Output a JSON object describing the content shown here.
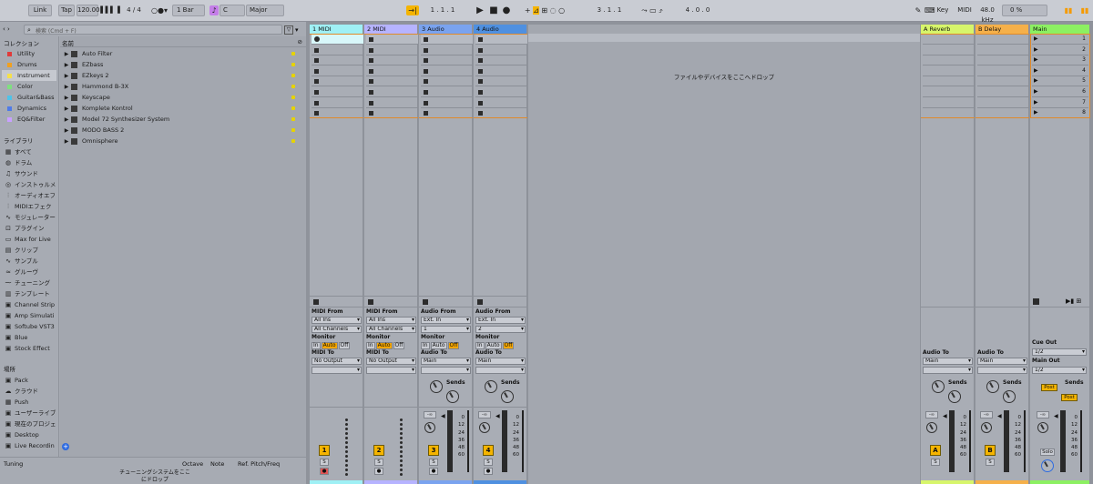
{
  "transport": {
    "link": "Link",
    "tap": "Tap",
    "tempo": "120.00",
    "time_sig": "4 / 4",
    "quantize": "1 Bar",
    "key": "C",
    "scale": "Major",
    "position": "1 .   1 .   1",
    "loop_start": "3 .   1 .   1",
    "loop_length": "4 .   0 .   0",
    "key_label": "Key",
    "midi_label": "MIDI",
    "sample_rate": "48.0 kHz",
    "cpu": "0 %"
  },
  "browser": {
    "search_placeholder": "検索 (Cmd + F)",
    "collections_header": "コレクション",
    "name_header": "名前",
    "collections": [
      {
        "label": "Utility",
        "color": "#e03b3b"
      },
      {
        "label": "Drums",
        "color": "#f0a020"
      },
      {
        "label": "Instrument",
        "color": "#f5e04a"
      },
      {
        "label": "Color",
        "color": "#7fe07f"
      },
      {
        "label": "Guitar&Bass",
        "color": "#4fc3e8"
      },
      {
        "label": "Dynamics",
        "color": "#4f7be8"
      },
      {
        "label": "EQ&Filter",
        "color": "#c9a0ff"
      }
    ],
    "library_header": "ライブラリ",
    "library": [
      {
        "label": "すべて",
        "icon": "grid-icon"
      },
      {
        "label": "ドラム",
        "icon": "drum-icon"
      },
      {
        "label": "サウンド",
        "icon": "sound-icon"
      },
      {
        "label": "インストゥルメ",
        "icon": "instrument-icon"
      },
      {
        "label": "オーディオエフ",
        "icon": "audio-fx-icon"
      },
      {
        "label": "MIDIエフェク",
        "icon": "midi-fx-icon"
      },
      {
        "label": "モジュレーター",
        "icon": "modulator-icon"
      },
      {
        "label": "プラグイン",
        "icon": "plugin-icon"
      },
      {
        "label": "Max for Live",
        "icon": "max-icon"
      },
      {
        "label": "クリップ",
        "icon": "clip-icon"
      },
      {
        "label": "サンプル",
        "icon": "sample-icon"
      },
      {
        "label": "グルーヴ",
        "icon": "groove-icon"
      },
      {
        "label": "チューニング",
        "icon": "tuning-icon"
      },
      {
        "label": "テンプレート",
        "icon": "template-icon"
      },
      {
        "label": "Channel Strip",
        "icon": "pack-icon"
      },
      {
        "label": "Amp Simulati",
        "icon": "pack-icon"
      },
      {
        "label": "Softube VST3",
        "icon": "pack-icon"
      },
      {
        "label": "Blue",
        "icon": "pack-icon"
      },
      {
        "label": "Stock Effect",
        "icon": "pack-icon"
      }
    ],
    "places_header": "場所",
    "places": [
      {
        "label": "Pack",
        "icon": "pack-icon"
      },
      {
        "label": "クラウド",
        "icon": "cloud-icon"
      },
      {
        "label": "Push",
        "icon": "push-icon"
      },
      {
        "label": "ユーザーライブ",
        "icon": "user-library-icon"
      },
      {
        "label": "現在のプロジェ",
        "icon": "project-icon"
      },
      {
        "label": "Desktop",
        "icon": "folder-icon"
      },
      {
        "label": "Live Recordin",
        "icon": "folder-icon"
      }
    ],
    "items": [
      {
        "label": "Auto Filter"
      },
      {
        "label": "EZbass"
      },
      {
        "label": "EZkeys 2"
      },
      {
        "label": "Hammond B-3X"
      },
      {
        "label": "Keyscape"
      },
      {
        "label": "Komplete Kontrol"
      },
      {
        "label": "Model 72 Synthesizer System"
      },
      {
        "label": "MODO BASS 2"
      },
      {
        "label": "Omnisphere"
      }
    ],
    "tuning": {
      "title": "Tuning",
      "col_octave": "Octave",
      "col_note": "Note",
      "col_ref": "Ref. Pitch/Freq",
      "drop_hint": "チューニングシステムをここにドロップ"
    }
  },
  "session": {
    "drop_hint": "ファイルやデバイスをここへドロップ",
    "tracks": [
      {
        "name": "1 MIDI",
        "color": "#9ff0f5",
        "type": "midi",
        "number": "1",
        "io_label": "MIDI From",
        "in": "All Ins",
        "ch": "All Channels",
        "out_label": "MIDI To",
        "out": "No Output"
      },
      {
        "name": "2 MIDI",
        "color": "#b6b3ff",
        "type": "midi",
        "number": "2",
        "io_label": "MIDI From",
        "in": "All Ins",
        "ch": "All Channels",
        "out_label": "MIDI To",
        "out": "No Output"
      },
      {
        "name": "3 Audio",
        "color": "#7aa3ef",
        "type": "audio",
        "number": "3",
        "io_label": "Audio From",
        "in": "Ext. In",
        "ch": "1",
        "out_label": "Audio To",
        "out": "Main"
      },
      {
        "name": "4 Audio",
        "color": "#4f90e0",
        "type": "audio",
        "number": "4",
        "io_label": "Audio From",
        "in": "Ext. In",
        "ch": "2",
        "out_label": "Audio To",
        "out": "Main"
      }
    ],
    "returns": [
      {
        "name": "A Reverb",
        "color": "#d7f56b",
        "letter": "A"
      },
      {
        "name": "B Delay",
        "color": "#f5b04a",
        "letter": "B"
      }
    ],
    "main": {
      "name": "Main",
      "color": "#8cf062",
      "scenes": [
        "1",
        "2",
        "3",
        "4",
        "5",
        "6",
        "7",
        "8"
      ],
      "cue_out_label": "Cue Out",
      "cue_out": "1/2",
      "main_out_label": "Main Out",
      "main_out": "1/2",
      "solo": "Solo"
    },
    "monitor": {
      "label": "Monitor",
      "in": "In",
      "auto": "Auto",
      "off": "Off"
    },
    "sends_label": "Sends",
    "audio_to_label": "Audio To",
    "return_out": "Main",
    "post": "Post",
    "vol": "-∞",
    "solo_btn": "S",
    "scale": [
      "0",
      "12",
      "24",
      "36",
      "48",
      "60"
    ]
  }
}
